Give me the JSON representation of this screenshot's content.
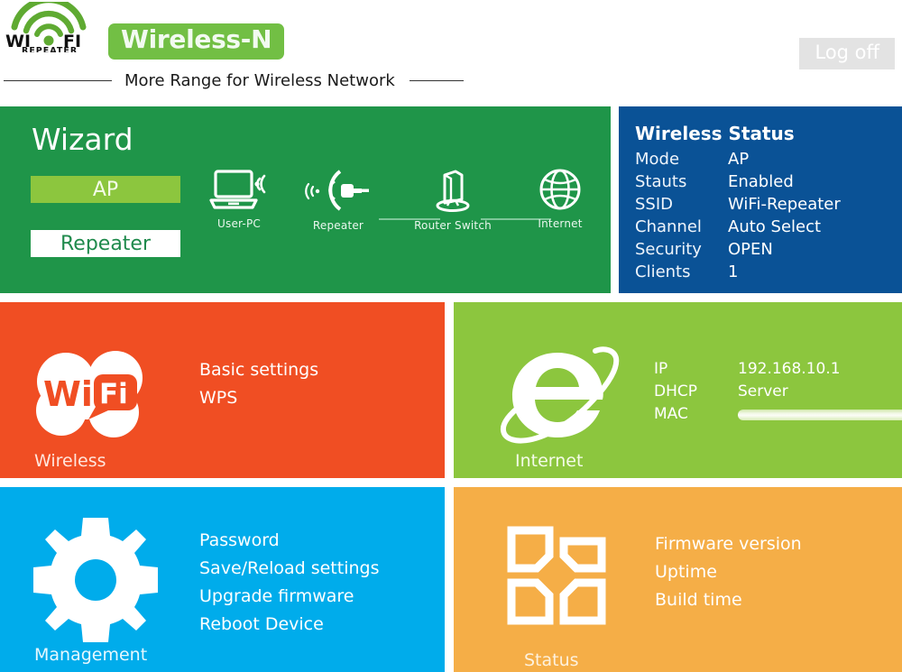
{
  "header": {
    "logo_text_primary": "WI",
    "logo_text_secondary": "FI",
    "logo_subtext": "REPEATER",
    "brand": "Wireless-N",
    "tagline": "More Range for Wireless Network",
    "logoff_label": "Log off"
  },
  "wizard": {
    "title": "Wizard",
    "mode_ap": "AP",
    "mode_repeater": "Repeater",
    "diagram": {
      "nodes": [
        {
          "id": "user-pc",
          "label": "User-PC"
        },
        {
          "id": "repeater",
          "label": "Repeater"
        },
        {
          "id": "router-switch",
          "label": "Router Switch"
        },
        {
          "id": "internet",
          "label": "Internet"
        }
      ]
    }
  },
  "wireless_status": {
    "title": "Wireless Status",
    "rows": [
      {
        "key": "Mode",
        "value": "AP"
      },
      {
        "key": "Stauts",
        "value": "Enabled"
      },
      {
        "key": "SSID",
        "value": "WiFi-Repeater"
      },
      {
        "key": "Channel",
        "value": "Auto Select"
      },
      {
        "key": "Security",
        "value": "OPEN"
      },
      {
        "key": "Clients",
        "value": "1"
      }
    ]
  },
  "wireless": {
    "corner_label": "Wireless",
    "links": [
      "Basic settings",
      "WPS"
    ]
  },
  "internet": {
    "corner_label": "Internet",
    "rows": [
      {
        "key": "IP",
        "value": "192.168.10.1"
      },
      {
        "key": "DHCP",
        "value": "Server"
      },
      {
        "key": "MAC",
        "value": ""
      }
    ]
  },
  "management": {
    "corner_label": "Management",
    "links": [
      "Password",
      "Save/Reload settings",
      "Upgrade firmware",
      "Reboot Device"
    ]
  },
  "status": {
    "corner_label": "Status",
    "links": [
      "Firmware version",
      "Uptime",
      "Build time"
    ]
  },
  "colors": {
    "wizard_green": "#1f9549",
    "accent_green": "#8cc63e",
    "status_blue": "#0a5296",
    "wireless_orange": "#f04e23",
    "management_blue": "#00aceb",
    "status_amber": "#f5ae47",
    "brand_green": "#72bf44"
  }
}
